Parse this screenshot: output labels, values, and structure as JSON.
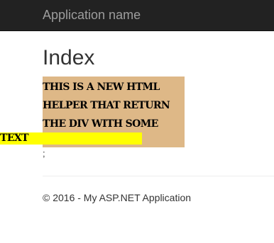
{
  "navbar": {
    "brand": "Application name"
  },
  "main": {
    "title": "Index",
    "helper_box": {
      "text_lines": [
        "This is a new HTML",
        "helper that return",
        "the div with some"
      ],
      "highlight_text": "text",
      "box_color": "#deb887",
      "highlight_color": "#ffff00"
    },
    "trailing_text": ";"
  },
  "footer": {
    "text": "© 2016 - My ASP.NET Application"
  },
  "colors": {
    "navbar_bg": "#222222",
    "brand_text": "#9d9d9d",
    "body_text": "#333333"
  }
}
